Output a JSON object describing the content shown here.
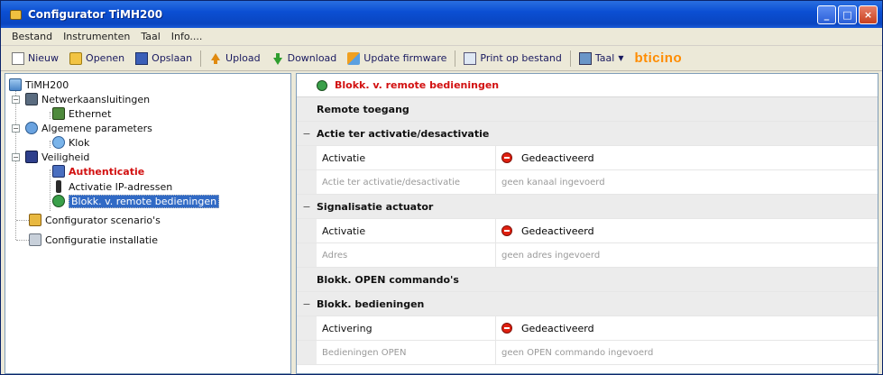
{
  "window": {
    "title": "Configurator TiMH200"
  },
  "menu": [
    "Bestand",
    "Instrumenten",
    "Taal",
    "Info...."
  ],
  "toolbar": {
    "new": "Nieuw",
    "open": "Openen",
    "save": "Opslaan",
    "upload": "Upload",
    "download": "Download",
    "firmware": "Update firmware",
    "print": "Print op bestand",
    "language": "Taal",
    "brand": "bticino"
  },
  "tree": {
    "root": "TiMH200",
    "network": "Netwerkaansluitingen",
    "ethernet": "Ethernet",
    "general": "Algemene parameters",
    "clock": "Klok",
    "security": "Veiligheid",
    "authentication": "Authenticatie",
    "ip_activation": "Activatie IP-adressen",
    "remote_block": "Blokk. v. remote bedieningen",
    "scenario_config": "Configurator scenario's",
    "installation_config": "Configuratie installatie"
  },
  "props": {
    "title": "Blokk. v. remote bedieningen",
    "remote_access": "Remote toegang",
    "sec1": {
      "label": "Actie ter activatie/desactivatie",
      "toggle": "−",
      "activation_label": "Activatie",
      "activation_value": "Gedeactiveerd",
      "action_label": "Actie ter activatie/desactivatie",
      "action_value": "geen kanaal ingevoerd"
    },
    "sec2": {
      "label": "Signalisatie actuator",
      "toggle": "−",
      "activation_label": "Activatie",
      "activation_value": "Gedeactiveerd",
      "address_label": "Adres",
      "address_value": "geen adres ingevoerd"
    },
    "open_commands": "Blokk. OPEN commando's",
    "sec3": {
      "label": "Blokk. bedieningen",
      "toggle": "−",
      "activation_label": "Activering",
      "activation_value": "Gedeactiveerd",
      "open_label": "Bedieningen OPEN",
      "open_value": "geen OPEN commando ingevoerd"
    }
  }
}
